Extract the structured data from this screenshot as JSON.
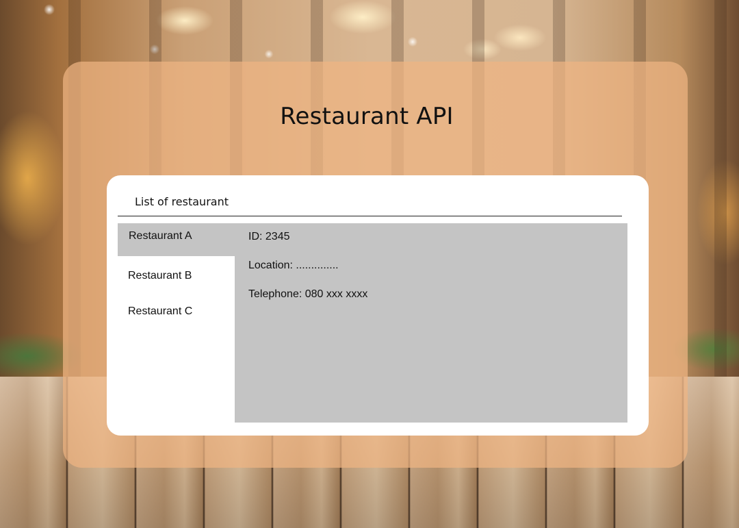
{
  "app": {
    "title": "Restaurant API"
  },
  "panel": {
    "title": "List of restaurant"
  },
  "restaurants": [
    {
      "label": "Restaurant A",
      "selected": true
    },
    {
      "label": "Restaurant B",
      "selected": false
    },
    {
      "label": "Restaurant C",
      "selected": false
    }
  ],
  "details": {
    "id": "ID: 2345",
    "location": "Location: ..............",
    "telephone": "Telephone: 080 xxx xxxx"
  },
  "colors": {
    "card": "#eeb482",
    "panel": "#ffffff",
    "selection": "#c4c4c4",
    "text": "#111111"
  }
}
